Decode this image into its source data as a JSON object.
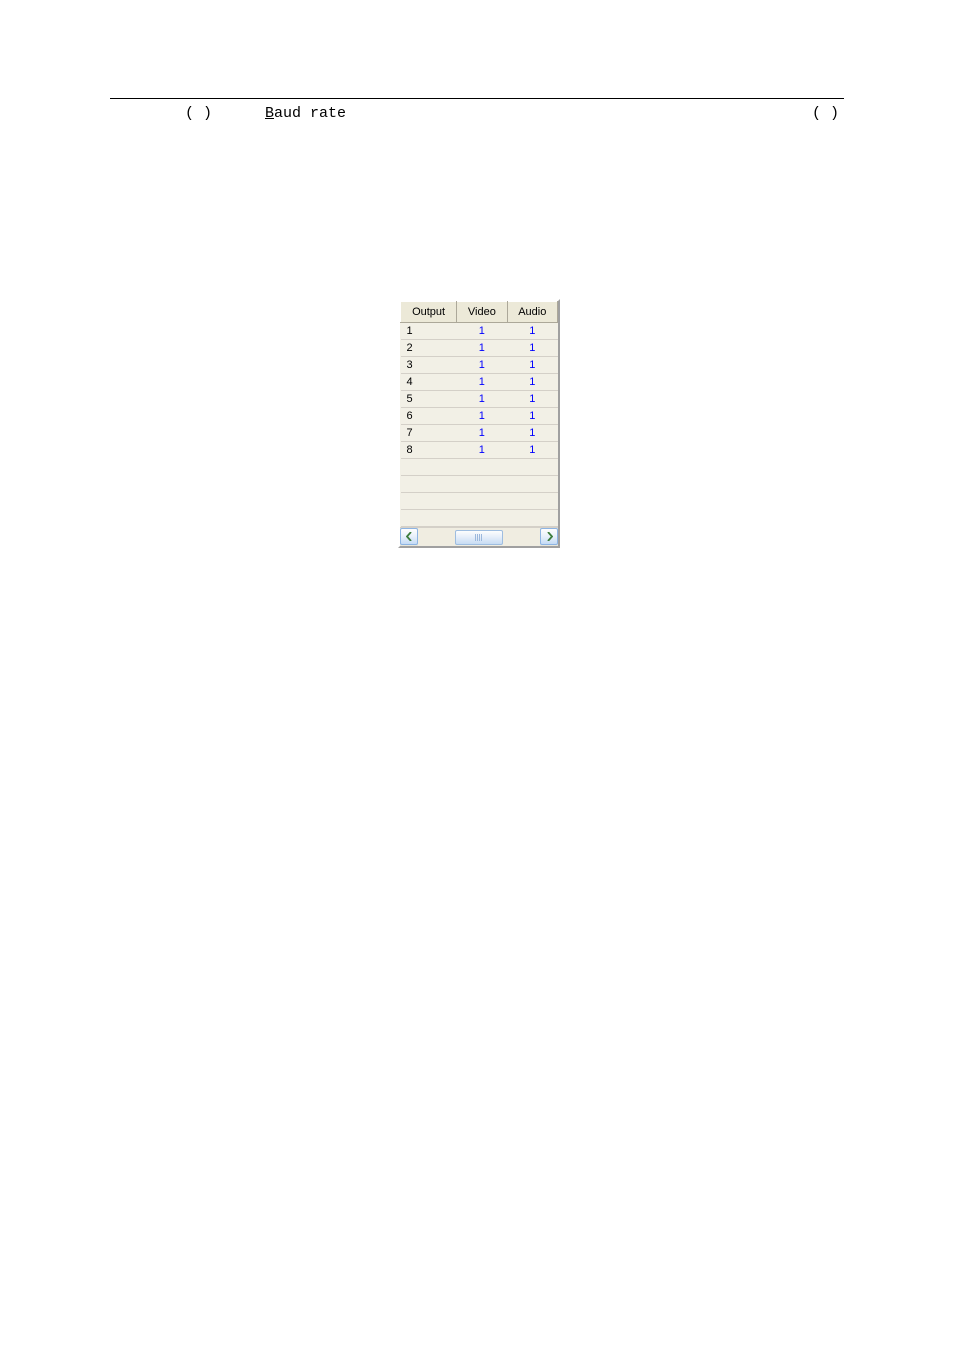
{
  "header": {
    "paren_left": "(  )",
    "baud_label_underline": "B",
    "baud_label_rest": "aud rate",
    "paren_right": "(  )"
  },
  "table": {
    "headers": {
      "output": "Output",
      "video": "Video",
      "audio": "Audio"
    },
    "rows": [
      {
        "output": "1",
        "video": "1",
        "audio": "1"
      },
      {
        "output": "2",
        "video": "1",
        "audio": "1"
      },
      {
        "output": "3",
        "video": "1",
        "audio": "1"
      },
      {
        "output": "4",
        "video": "1",
        "audio": "1"
      },
      {
        "output": "5",
        "video": "1",
        "audio": "1"
      },
      {
        "output": "6",
        "video": "1",
        "audio": "1"
      },
      {
        "output": "7",
        "video": "1",
        "audio": "1"
      },
      {
        "output": "8",
        "video": "1",
        "audio": "1"
      }
    ],
    "empty_rows": 4
  }
}
